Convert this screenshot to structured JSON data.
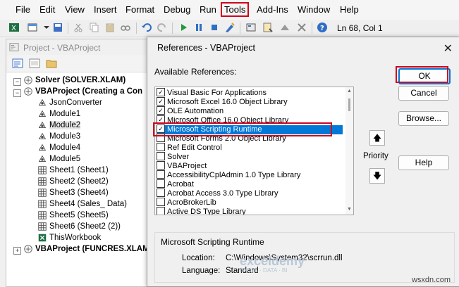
{
  "menu": {
    "items": [
      "File",
      "Edit",
      "View",
      "Insert",
      "Format",
      "Debug",
      "Run",
      "Tools",
      "Add-Ins",
      "Window",
      "Help"
    ]
  },
  "toolbar": {
    "status": "Ln 68, Col 1"
  },
  "project": {
    "title": "Project - VBAProject",
    "tree": [
      {
        "label": "Solver (SOLVER.XLAM)",
        "bold": true
      },
      {
        "label": "VBAProject (Creating a Con",
        "bold": true
      },
      {
        "label": "JsonConverter"
      },
      {
        "label": "Module1"
      },
      {
        "label": "Module2",
        "selected": true
      },
      {
        "label": "Module3"
      },
      {
        "label": "Module4"
      },
      {
        "label": "Module5"
      },
      {
        "label": "Sheet1 (Sheet1)"
      },
      {
        "label": "Sheet2 (Sheet2)"
      },
      {
        "label": "Sheet3 (Sheet4)"
      },
      {
        "label": "Sheet4 (Sales_ Data)"
      },
      {
        "label": "Sheet5 (Sheet5)"
      },
      {
        "label": "Sheet6 (Sheet2 (2))"
      },
      {
        "label": "ThisWorkbook"
      },
      {
        "label": "VBAProject (FUNCRES.XLAM",
        "bold": true
      }
    ]
  },
  "dialog": {
    "title": "References - VBAProject",
    "available_label": "Available References:",
    "references": [
      {
        "label": "Visual Basic For Applications",
        "checked": true
      },
      {
        "label": "Microsoft Excel 16.0 Object Library",
        "checked": true
      },
      {
        "label": "OLE Automation",
        "checked": true
      },
      {
        "label": "Microsoft Office 16.0 Object Library",
        "checked": true
      },
      {
        "label": "Microsoft Scripting Runtime",
        "checked": true,
        "selected": true
      },
      {
        "label": "Microsoft Forms 2.0 Object Library",
        "checked": false
      },
      {
        "label": "Ref Edit Control",
        "checked": false
      },
      {
        "label": "Solver",
        "checked": false
      },
      {
        "label": "VBAProject",
        "checked": false
      },
      {
        "label": "AccessibilityCplAdmin 1.0 Type Library",
        "checked": false
      },
      {
        "label": "Acrobat",
        "checked": false
      },
      {
        "label": "Acrobat Access 3.0 Type Library",
        "checked": false
      },
      {
        "label": "AcroBrokerLib",
        "checked": false
      },
      {
        "label": "Active DS Type Library",
        "checked": false
      }
    ],
    "buttons": {
      "ok": "OK",
      "cancel": "Cancel",
      "browse": "Browse...",
      "help": "Help"
    },
    "priority_label": "Priority",
    "details": {
      "name": "Microsoft Scripting Runtime",
      "location_label": "Location:",
      "location_value": "C:\\Windows\\System32\\scrrun.dll",
      "language_label": "Language:",
      "language_value": "Standard"
    },
    "watermark": {
      "name": "exceldemy",
      "tagline": "EXCEL · DATA · BI"
    }
  },
  "branding": "wsxdn.com",
  "colors": {
    "highlight": "#d0021b",
    "selection": "#0078d7"
  }
}
